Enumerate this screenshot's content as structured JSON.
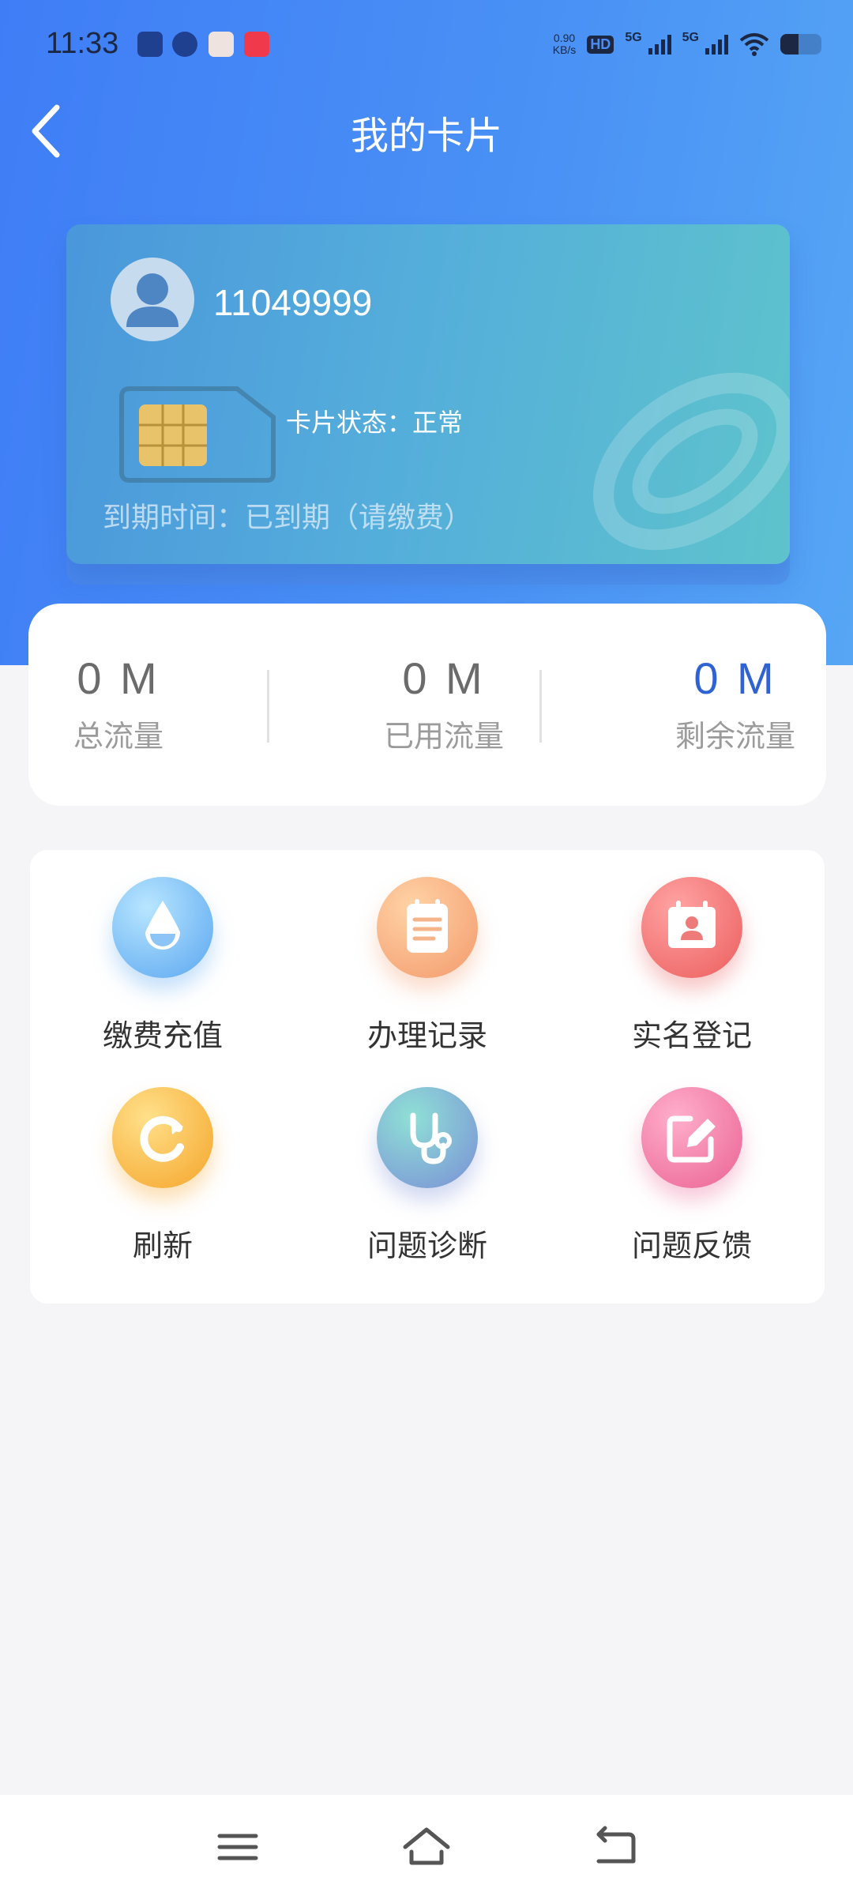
{
  "status_bar": {
    "time": "11:33",
    "net_speed_value": "0.90",
    "net_speed_unit": "KB/s",
    "hd_label": "HD",
    "sim1_label": "5G",
    "sim2_label": "5G",
    "battery_level": 0.45
  },
  "header": {
    "title": "我的卡片",
    "back_icon": "chevron-left-icon"
  },
  "card": {
    "number": "11049999",
    "status": "卡片状态：正常",
    "expiry": "到期时间：已到期（请缴费）",
    "colors": {
      "gradient_start": "#4a97db",
      "gradient_end": "#5ec3cc"
    }
  },
  "traffic": {
    "total": {
      "value": "0 M",
      "label": "总流量"
    },
    "used": {
      "value": "0 M",
      "label": "已用流量"
    },
    "remaining": {
      "value": "0 M",
      "label": "剩余流量",
      "color": "#2f63d4"
    }
  },
  "menu": [
    {
      "label": "缴费充值",
      "icon": "water-drop-icon"
    },
    {
      "label": "办理记录",
      "icon": "notepad-icon"
    },
    {
      "label": "实名登记",
      "icon": "id-card-icon"
    },
    {
      "label": "刷新",
      "icon": "refresh-icon"
    },
    {
      "label": "问题诊断",
      "icon": "stethoscope-icon"
    },
    {
      "label": "问题反馈",
      "icon": "edit-icon"
    }
  ],
  "navbar": {
    "menu_icon": "menu-icon",
    "home_icon": "home-icon",
    "back_icon": "back-icon"
  }
}
